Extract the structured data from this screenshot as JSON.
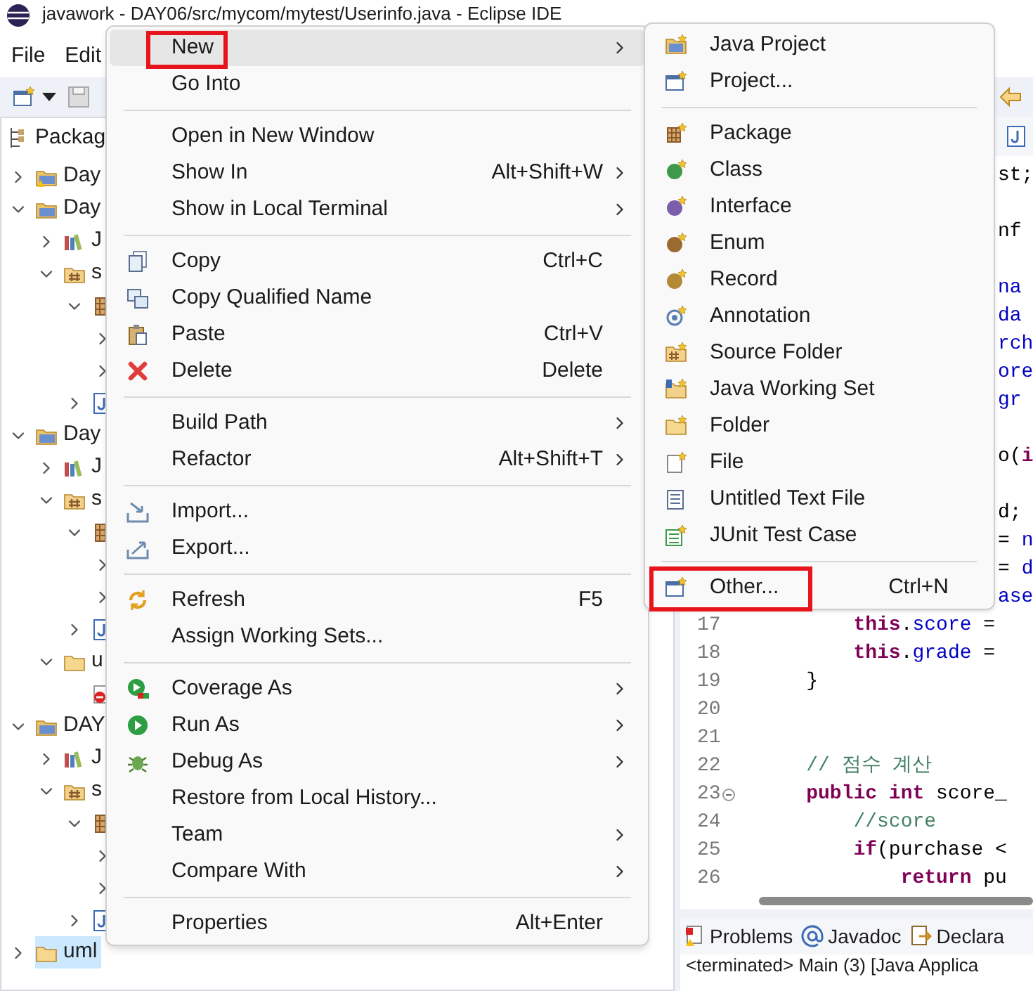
{
  "window": {
    "title": "javawork - DAY06/src/mycom/mytest/Userinfo.java - Eclipse IDE"
  },
  "menubar": [
    "File",
    "Edit"
  ],
  "explorer": {
    "title": "Packag",
    "tree": [
      {
        "label": "Day",
        "kind": "project-warn",
        "expanded": false,
        "selected": false
      },
      {
        "label": "Day",
        "kind": "project",
        "expanded": true,
        "selected": false,
        "children": [
          {
            "label": "J",
            "kind": "library",
            "expanded": false,
            "selected": false
          },
          {
            "label": "s",
            "kind": "src",
            "expanded": true,
            "selected": false,
            "children": [
              {
                "kind": "package",
                "expanded": true,
                "selected": false,
                "children": [
                  {
                    "expanded": false
                  },
                  {
                    "expanded": false
                  }
                ]
              },
              {
                "kind": "java-file",
                "expanded": false,
                "selected": false
              }
            ]
          }
        ]
      },
      {
        "label": "Day",
        "kind": "project",
        "expanded": true,
        "selected": false,
        "children": [
          {
            "label": "J",
            "kind": "library",
            "expanded": false,
            "selected": false
          },
          {
            "label": "s",
            "kind": "src",
            "expanded": true,
            "selected": false,
            "children": [
              {
                "kind": "package",
                "expanded": true,
                "selected": false,
                "children": [
                  {
                    "expanded": false
                  },
                  {
                    "expanded": false
                  }
                ]
              },
              {
                "kind": "java-file",
                "expanded": false,
                "selected": false
              }
            ]
          },
          {
            "label": "u",
            "kind": "folder",
            "expanded": true,
            "selected": false,
            "children": [
              {
                "kind": "error-file",
                "selected": false
              }
            ]
          }
        ]
      },
      {
        "label": "DAY",
        "kind": "project",
        "expanded": true,
        "selected": false,
        "children": [
          {
            "label": "J",
            "kind": "library",
            "expanded": false,
            "selected": false
          },
          {
            "label": "s",
            "kind": "src",
            "expanded": true,
            "selected": false,
            "children": [
              {
                "kind": "package",
                "expanded": true,
                "selected": false,
                "children": [
                  {
                    "expanded": false
                  },
                  {
                    "expanded": false
                  }
                ]
              },
              {
                "kind": "java-file",
                "expanded": false,
                "selected": false
              }
            ]
          }
        ]
      },
      {
        "label": "uml",
        "kind": "folder",
        "expanded": false,
        "selected": true
      }
    ]
  },
  "editor": {
    "lines": [
      {
        "kind": "covered",
        "segments": [
          {
            "kind": "plain",
            "text": "st;"
          }
        ]
      },
      {
        "kind": "covered"
      },
      {
        "kind": "covered",
        "segments": [
          {
            "kind": "plain",
            "text": "nf"
          }
        ]
      },
      {
        "kind": "covered"
      },
      {
        "kind": "covered",
        "segments": [
          {
            "kind": "field",
            "text": "na"
          }
        ]
      },
      {
        "kind": "covered",
        "segments": [
          {
            "kind": "field",
            "text": "da"
          }
        ]
      },
      {
        "kind": "covered",
        "segments": [
          {
            "kind": "field",
            "text": "rch"
          }
        ]
      },
      {
        "kind": "covered",
        "segments": [
          {
            "kind": "field",
            "text": "ore"
          }
        ]
      },
      {
        "kind": "covered",
        "segments": [
          {
            "kind": "field",
            "text": "gr"
          }
        ]
      },
      {
        "kind": "covered"
      },
      {
        "kind": "covered",
        "segments": [
          {
            "kind": "plain",
            "text": "o("
          },
          {
            "kind": "keyword",
            "text": "i"
          }
        ]
      },
      {
        "kind": "covered"
      },
      {
        "kind": "covered",
        "segments": [
          {
            "kind": "plain",
            "text": "d;"
          }
        ]
      },
      {
        "kind": "covered",
        "segments": [
          {
            "kind": "plain",
            "text": "= "
          },
          {
            "kind": "field",
            "text": "n"
          }
        ]
      },
      {
        "kind": "covered",
        "segments": [
          {
            "kind": "plain",
            "text": "= "
          },
          {
            "kind": "field",
            "text": "d"
          }
        ]
      },
      {
        "kind": "covered",
        "segments": [
          {
            "kind": "field",
            "text": "ase"
          }
        ]
      },
      {
        "kind": "full",
        "number": "17",
        "foldable": false,
        "segments": [
          {
            "kind": "keyword",
            "text": "\t\tthis"
          },
          {
            "kind": "plain",
            "text": "."
          },
          {
            "kind": "field",
            "text": "score"
          },
          {
            "kind": "plain",
            "text": " ="
          }
        ]
      },
      {
        "kind": "full",
        "number": "18",
        "foldable": false,
        "segments": [
          {
            "kind": "keyword",
            "text": "\t\tthis"
          },
          {
            "kind": "plain",
            "text": "."
          },
          {
            "kind": "field",
            "text": "grade"
          },
          {
            "kind": "plain",
            "text": " ="
          }
        ]
      },
      {
        "kind": "full",
        "number": "19",
        "foldable": false,
        "segments": [
          {
            "kind": "plain",
            "text": "\t}"
          }
        ]
      },
      {
        "kind": "full",
        "number": "20",
        "foldable": false
      },
      {
        "kind": "full",
        "number": "21",
        "foldable": false
      },
      {
        "kind": "full",
        "number": "22",
        "foldable": false,
        "segments": [
          {
            "kind": "comment",
            "text": "\t// 점수 계산"
          }
        ]
      },
      {
        "kind": "full",
        "number": "23",
        "foldable": true,
        "segments": [
          {
            "kind": "keyword",
            "text": "\tpublic int"
          },
          {
            "kind": "plain",
            "text": " score_"
          }
        ]
      },
      {
        "kind": "full",
        "number": "24",
        "foldable": false,
        "segments": [
          {
            "kind": "comment",
            "text": "\t\t//score"
          }
        ]
      },
      {
        "kind": "full",
        "number": "25",
        "foldable": false,
        "segments": [
          {
            "kind": "keyword",
            "text": "\t\tif"
          },
          {
            "kind": "plain",
            "text": "(purchase <"
          }
        ]
      },
      {
        "kind": "full",
        "number": "26",
        "foldable": false,
        "segments": [
          {
            "kind": "keyword",
            "text": "\t\t\treturn"
          },
          {
            "kind": "plain",
            "text": " pu"
          }
        ]
      }
    ]
  },
  "bottom_panel": {
    "tabs": [
      {
        "label": "Problems",
        "kind": "problems"
      },
      {
        "label": "Javadoc",
        "kind": "javadoc"
      },
      {
        "label": "Declara",
        "kind": "declaration"
      }
    ],
    "console": "<terminated> Main (3) [Java Applica"
  },
  "context_menu": {
    "items": [
      {
        "kind": "plain",
        "label": "New",
        "submenu": true,
        "selected": true,
        "outlined": true
      },
      {
        "kind": "plain",
        "label": "Go Into",
        "submenu": false,
        "selected": false,
        "outlined": false
      },
      {
        "kind": "separator"
      },
      {
        "kind": "plain",
        "label": "Open in New Window",
        "submenu": false,
        "selected": false,
        "outlined": false
      },
      {
        "kind": "plain",
        "label": "Show In",
        "shortcut": "Alt+Shift+W",
        "submenu": true,
        "selected": false,
        "outlined": false
      },
      {
        "kind": "plain",
        "label": "Show in Local Terminal",
        "submenu": true,
        "selected": false,
        "outlined": false
      },
      {
        "kind": "separator"
      },
      {
        "kind": "copy",
        "label": "Copy",
        "shortcut": "Ctrl+C",
        "submenu": false,
        "selected": false,
        "outlined": false
      },
      {
        "kind": "copy-name",
        "label": "Copy Qualified Name",
        "submenu": false,
        "selected": false,
        "outlined": false
      },
      {
        "kind": "paste",
        "label": "Paste",
        "shortcut": "Ctrl+V",
        "submenu": false,
        "selected": false,
        "outlined": false
      },
      {
        "kind": "delete",
        "label": "Delete",
        "shortcut": "Delete",
        "submenu": false,
        "selected": false,
        "outlined": false
      },
      {
        "kind": "separator"
      },
      {
        "kind": "plain",
        "label": "Build Path",
        "submenu": true,
        "selected": false,
        "outlined": false
      },
      {
        "kind": "plain",
        "label": "Refactor",
        "shortcut": "Alt+Shift+T",
        "submenu": true,
        "selected": false,
        "outlined": false
      },
      {
        "kind": "separator"
      },
      {
        "kind": "import",
        "label": "Import...",
        "submenu": false,
        "selected": false,
        "outlined": false
      },
      {
        "kind": "export",
        "label": "Export...",
        "submenu": false,
        "selected": false,
        "outlined": false
      },
      {
        "kind": "separator"
      },
      {
        "kind": "refresh",
        "label": "Refresh",
        "shortcut": "F5",
        "submenu": false,
        "selected": false,
        "outlined": false
      },
      {
        "kind": "plain",
        "label": "Assign Working Sets...",
        "submenu": false,
        "selected": false,
        "outlined": false
      },
      {
        "kind": "separator"
      },
      {
        "kind": "coverage",
        "label": "Coverage As",
        "submenu": true,
        "selected": false,
        "outlined": false
      },
      {
        "kind": "run",
        "label": "Run As",
        "submenu": true,
        "selected": false,
        "outlined": false
      },
      {
        "kind": "debug",
        "label": "Debug As",
        "submenu": true,
        "selected": false,
        "outlined": false
      },
      {
        "kind": "plain",
        "label": "Restore from Local History...",
        "submenu": false,
        "selected": false,
        "outlined": false
      },
      {
        "kind": "plain",
        "label": "Team",
        "submenu": true,
        "selected": false,
        "outlined": false
      },
      {
        "kind": "plain",
        "label": "Compare With",
        "submenu": true,
        "selected": false,
        "outlined": false
      },
      {
        "kind": "separator"
      },
      {
        "kind": "plain",
        "label": "Properties",
        "shortcut": "Alt+Enter",
        "submenu": false,
        "selected": false,
        "outlined": false
      }
    ]
  },
  "new_submenu": {
    "items": [
      {
        "kind": "java-project",
        "label": "Java Project",
        "selected": false,
        "outlined": false
      },
      {
        "kind": "project-new",
        "label": "Project...",
        "selected": false,
        "outlined": false
      },
      {
        "kind": "separator"
      },
      {
        "kind": "package-new",
        "label": "Package",
        "selected": false,
        "outlined": false
      },
      {
        "kind": "class",
        "label": "Class",
        "selected": false,
        "outlined": false
      },
      {
        "kind": "interface",
        "label": "Interface",
        "selected": false,
        "outlined": false
      },
      {
        "kind": "enum",
        "label": "Enum",
        "selected": false,
        "outlined": false
      },
      {
        "kind": "record",
        "label": "Record",
        "selected": false,
        "outlined": false
      },
      {
        "kind": "annotation",
        "label": "Annotation",
        "selected": false,
        "outlined": false
      },
      {
        "kind": "source-folder",
        "label": "Source Folder",
        "selected": false,
        "outlined": false
      },
      {
        "kind": "working-set",
        "label": "Java Working Set",
        "selected": false,
        "outlined": false
      },
      {
        "kind": "folder-new",
        "label": "Folder",
        "selected": false,
        "outlined": false
      },
      {
        "kind": "file-new",
        "label": "File",
        "selected": false,
        "outlined": false
      },
      {
        "kind": "text-file",
        "label": "Untitled Text File",
        "selected": false,
        "outlined": false
      },
      {
        "kind": "junit",
        "label": "JUnit Test Case",
        "selected": false,
        "outlined": false
      },
      {
        "kind": "separator"
      },
      {
        "kind": "other",
        "label": "Other...",
        "shortcut": "Ctrl+N",
        "selected": false,
        "outlined": true
      }
    ]
  }
}
